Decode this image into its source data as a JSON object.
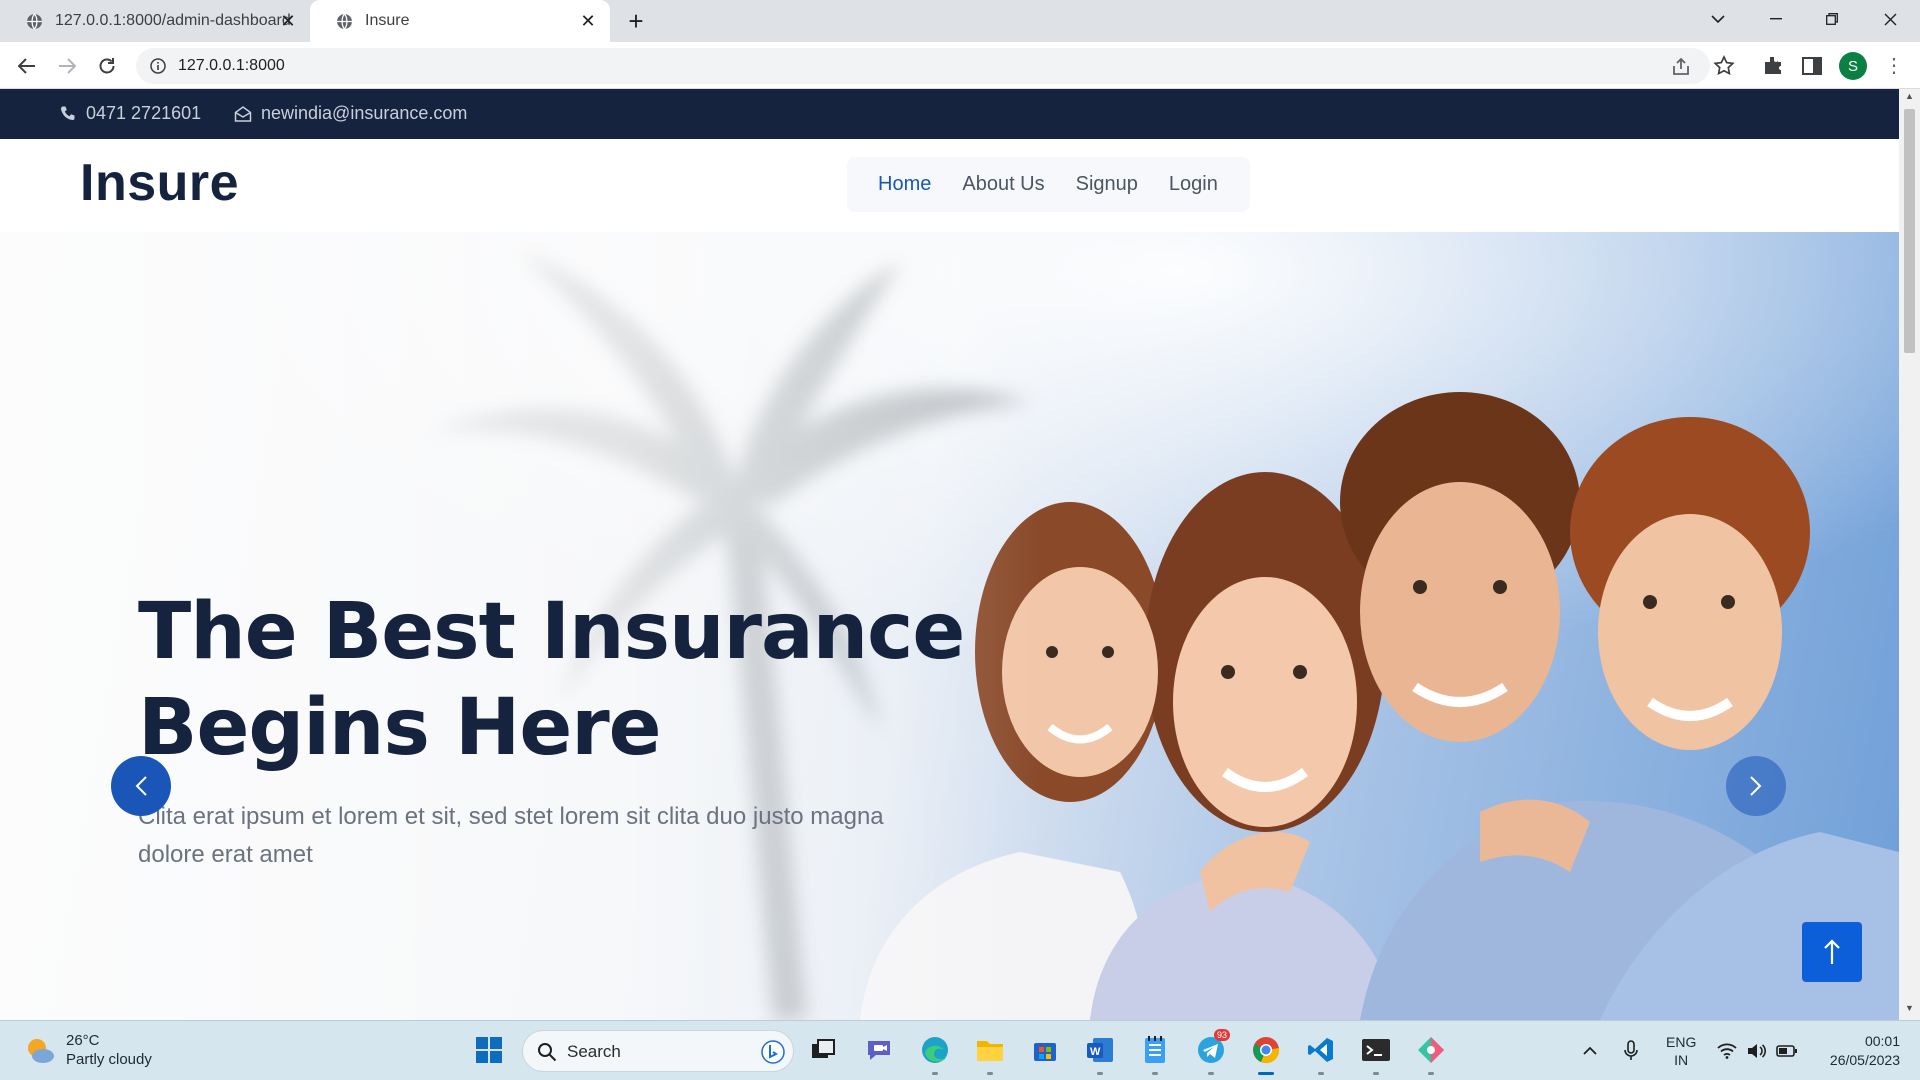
{
  "browser": {
    "tabs": [
      {
        "title": "127.0.0.1:8000/admin-dashboard",
        "active": false
      },
      {
        "title": "Insure",
        "active": true
      }
    ],
    "url": "127.0.0.1:8000",
    "profile_initial": "S"
  },
  "site": {
    "contact": {
      "phone": "0471 2721601",
      "email": "newindia@insurance.com"
    },
    "brand": "Insure",
    "nav": [
      {
        "label": "Home",
        "active": true
      },
      {
        "label": "About Us",
        "active": false
      },
      {
        "label": "Signup",
        "active": false
      },
      {
        "label": "Login",
        "active": false
      }
    ],
    "hero": {
      "title_line1": "The Best Insurance",
      "title_line2": "Begins Here",
      "text_line1": "Clita erat ipsum et lorem et sit, sed stet lorem sit clita duo justo magna",
      "text_line2": "dolore erat amet"
    },
    "colors": {
      "brand_dark": "#15233f",
      "accent_blue": "#1a56b8",
      "back_to_top": "#0d5fd9"
    }
  },
  "taskbar": {
    "weather": {
      "temp": "26°C",
      "condition": "Partly cloudy"
    },
    "search_placeholder": "Search",
    "telegram_badge": "93",
    "language": {
      "line1": "ENG",
      "line2": "IN"
    },
    "clock": {
      "time": "00:01",
      "date": "26/05/2023"
    }
  }
}
